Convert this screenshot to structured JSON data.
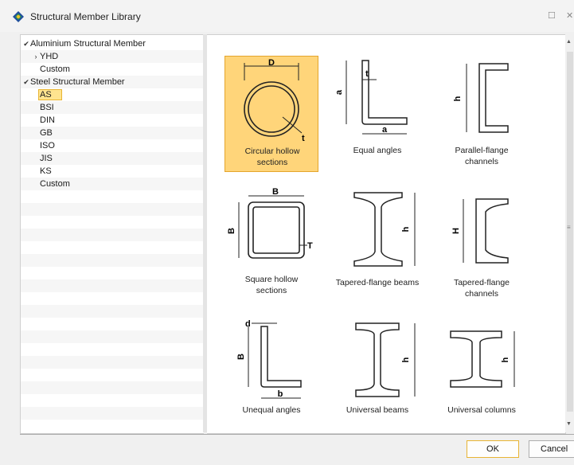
{
  "window": {
    "title": "Structural Member Library",
    "minimize_glyph": "☐",
    "close_glyph": "✕"
  },
  "tree": [
    {
      "label": "Aluminium Structural Member",
      "level": 0,
      "arrow": "✔",
      "expanded": true
    },
    {
      "label": "YHD",
      "level": 1,
      "arrow": "›",
      "expanded": false
    },
    {
      "label": "Custom",
      "level": 1,
      "arrow": ""
    },
    {
      "label": "Steel Structural Member",
      "level": 0,
      "arrow": "✔",
      "expanded": true
    },
    {
      "label": "AS",
      "level": 1,
      "arrow": "",
      "selected": true
    },
    {
      "label": "BSI",
      "level": 1,
      "arrow": ""
    },
    {
      "label": "DIN",
      "level": 1,
      "arrow": ""
    },
    {
      "label": "GB",
      "level": 1,
      "arrow": ""
    },
    {
      "label": "ISO",
      "level": 1,
      "arrow": ""
    },
    {
      "label": "JIS",
      "level": 1,
      "arrow": ""
    },
    {
      "label": "KS",
      "level": 1,
      "arrow": ""
    },
    {
      "label": "Custom",
      "level": 1,
      "arrow": ""
    }
  ],
  "sections": [
    {
      "id": "chs",
      "line1": "Circular hollow",
      "line2": "sections",
      "selected": true,
      "icon": "circular-hollow-section-icon",
      "dims": [
        "D",
        "t"
      ]
    },
    {
      "id": "ea",
      "line1": "Equal angles",
      "line2": "",
      "icon": "equal-angle-icon",
      "dims": [
        "a",
        "t",
        "a"
      ]
    },
    {
      "id": "pfc",
      "line1": "Parallel-flange",
      "line2": "channels",
      "icon": "parallel-flange-channel-icon",
      "dims": [
        "h"
      ]
    },
    {
      "id": "shs",
      "line1": "Square hollow",
      "line2": "sections",
      "icon": "square-hollow-section-icon",
      "dims": [
        "B",
        "B",
        "T"
      ]
    },
    {
      "id": "tfb",
      "line1": "Tapered-flange beams",
      "line2": "",
      "icon": "tapered-flange-beam-icon",
      "dims": [
        "h"
      ]
    },
    {
      "id": "tfc",
      "line1": "Tapered-flange",
      "line2": "channels",
      "icon": "tapered-flange-channel-icon",
      "dims": [
        "H"
      ]
    },
    {
      "id": "ua",
      "line1": "Unequal angles",
      "line2": "",
      "icon": "unequal-angle-icon",
      "dims": [
        "d",
        "B",
        "b"
      ]
    },
    {
      "id": "ub",
      "line1": "Universal beams",
      "line2": "",
      "icon": "universal-beam-icon",
      "dims": [
        "h"
      ]
    },
    {
      "id": "uc",
      "line1": "Universal columns",
      "line2": "",
      "icon": "universal-column-icon",
      "dims": [
        "h"
      ]
    }
  ],
  "buttons": {
    "ok": "OK",
    "cancel": "Cancel"
  },
  "colors": {
    "selection_fill": "#ffd57a",
    "selection_border": "#e4a52c",
    "tree_selection": "#ffe48f"
  }
}
